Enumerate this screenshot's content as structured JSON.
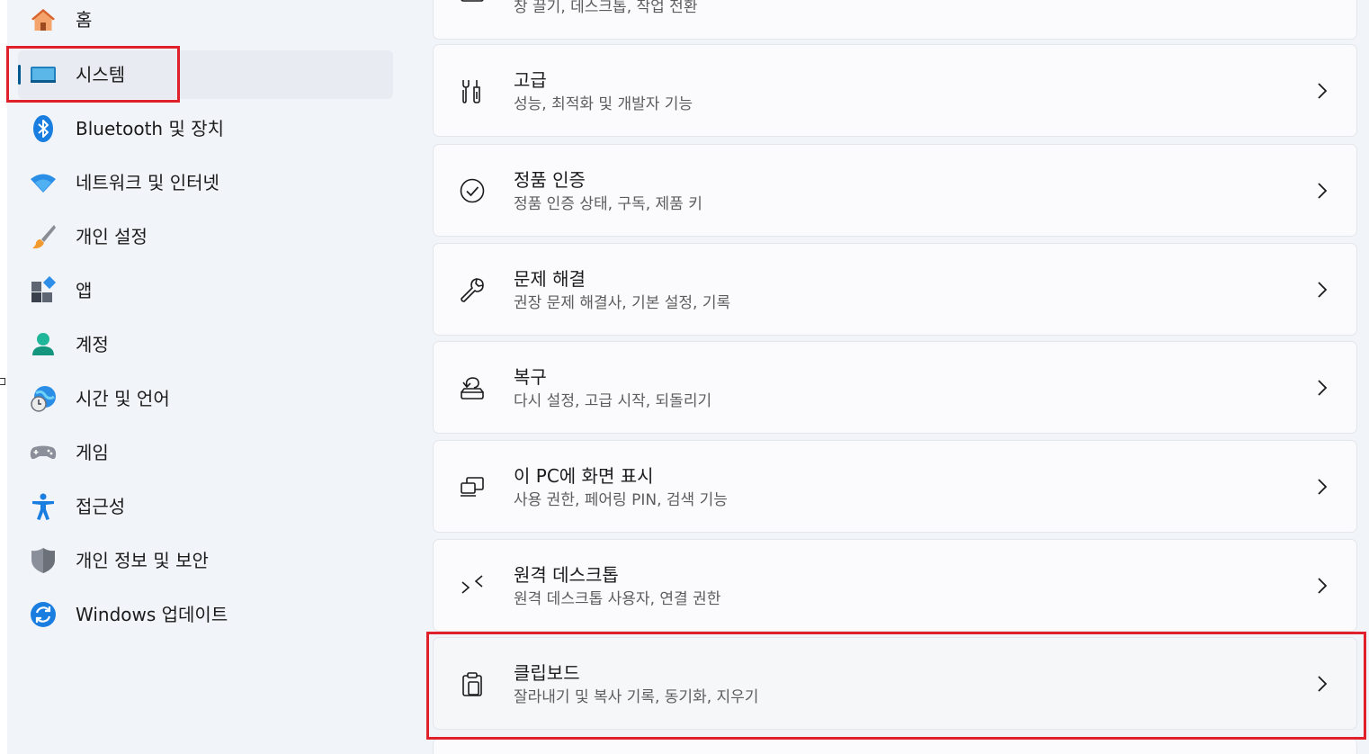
{
  "sidebar": {
    "items": [
      {
        "label": "홈"
      },
      {
        "label": "시스템"
      },
      {
        "label": "Bluetooth 및 장치"
      },
      {
        "label": "네트워크 및 인터넷"
      },
      {
        "label": "개인 설정"
      },
      {
        "label": "앱"
      },
      {
        "label": "계정"
      },
      {
        "label": "시간 및 언어"
      },
      {
        "label": "게임"
      },
      {
        "label": "접근성"
      },
      {
        "label": "개인 정보 및 보안"
      },
      {
        "label": "Windows 업데이트"
      }
    ],
    "selected": "시스템"
  },
  "main": {
    "cards": [
      {
        "subtitle": "창 끌기, 데스크톱, 작업 전환",
        "icon": "window-icon"
      },
      {
        "title": "고급",
        "subtitle": "성능, 최적화 및 개발자 기능",
        "icon": "tools-icon"
      },
      {
        "title": "정품 인증",
        "subtitle": "정품 인증 상태, 구독, 제품 키",
        "icon": "check-circle-icon"
      },
      {
        "title": "문제 해결",
        "subtitle": "권장 문제 해결사, 기본 설정, 기록",
        "icon": "wrench-icon"
      },
      {
        "title": "복구",
        "subtitle": "다시 설정, 고급 시작, 되돌리기",
        "icon": "recovery-icon"
      },
      {
        "title": "이 PC에 화면 표시",
        "subtitle": "사용 권한, 페어링 PIN, 검색 기능",
        "icon": "project-icon"
      },
      {
        "title": "원격 데스크톱",
        "subtitle": "원격 데스크톱 사용자, 연결 권한",
        "icon": "remote-desktop-icon"
      },
      {
        "title": "클립보드",
        "subtitle": "잘라내기 및 복사 기록, 동기화, 지우기",
        "icon": "clipboard-icon"
      }
    ]
  },
  "colors": {
    "accent": "#005a8f",
    "highlight": "#e0202a",
    "background": "#f1f4f9"
  }
}
